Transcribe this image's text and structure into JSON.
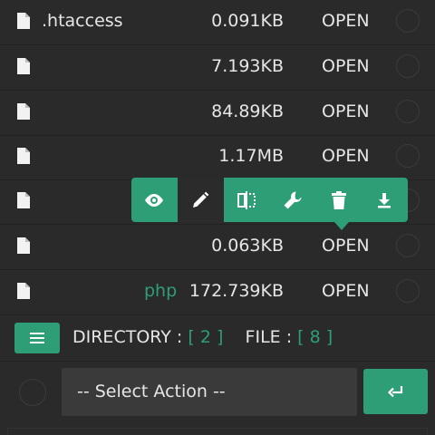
{
  "colors": {
    "accent": "#2e9e77",
    "background": "#2a2a2a",
    "text": "#e6e6e6"
  },
  "files": [
    {
      "name": ".htaccess",
      "ext": "",
      "size": "0.091KB",
      "open_label": "OPEN"
    },
    {
      "name": "",
      "ext": "",
      "size": "7.193KB",
      "open_label": "OPEN"
    },
    {
      "name": "",
      "ext": "",
      "size": "84.89KB",
      "open_label": "OPEN"
    },
    {
      "name": "",
      "ext": "",
      "size": "1.17MB",
      "open_label": "OPEN"
    },
    {
      "name": "",
      "ext": "",
      "size": "",
      "open_label": ""
    },
    {
      "name": "",
      "ext": "",
      "size": "0.063KB",
      "open_label": "OPEN"
    },
    {
      "name": "",
      "ext": "php",
      "size": "172.739KB",
      "open_label": "OPEN"
    }
  ],
  "toolbar": {
    "buttons": [
      "eye-icon",
      "pencil-icon",
      "split-icon",
      "wrench-icon",
      "trash-icon",
      "download-icon"
    ],
    "active_index": 1
  },
  "summary": {
    "directory_label": "DIRECTORY :",
    "directory_count": "2",
    "file_label": "FILE :",
    "file_count": "8"
  },
  "action": {
    "select_placeholder": "-- Select Action --"
  }
}
